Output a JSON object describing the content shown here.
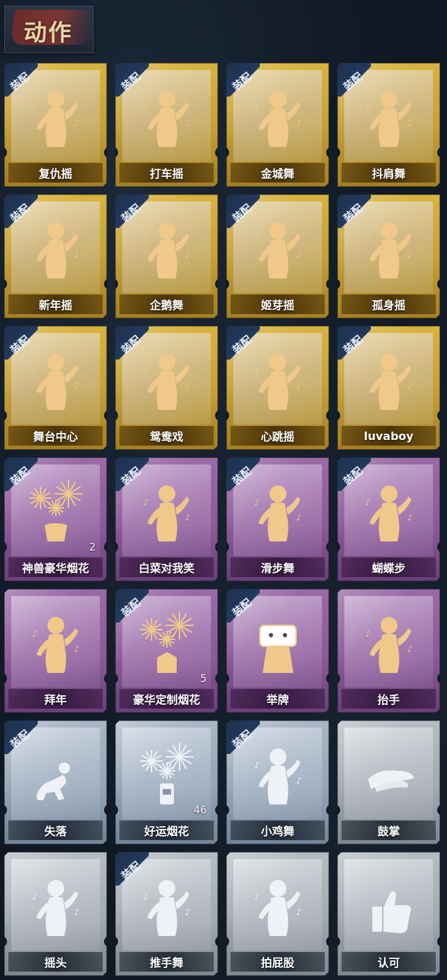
{
  "header": {
    "title": "动作"
  },
  "equip_label": "装配",
  "colors": {
    "gold": "#c7a137",
    "purple": "#8b5b98",
    "silver": "#95a4b5",
    "gray": "#a3a9b1",
    "figure": "#f0c98a"
  },
  "cards": [
    {
      "name": "复仇摇",
      "tier": "gold",
      "equipped": true,
      "icon": "dancer-arm-raised-icon",
      "count": ""
    },
    {
      "name": "打车摇",
      "tier": "gold",
      "equipped": true,
      "icon": "dancer-icon",
      "count": ""
    },
    {
      "name": "金城舞",
      "tier": "gold",
      "equipped": true,
      "icon": "dancer-wave-icon",
      "count": ""
    },
    {
      "name": "抖肩舞",
      "tier": "gold",
      "equipped": true,
      "icon": "dancer-shrug-icon",
      "count": ""
    },
    {
      "name": "新年摇",
      "tier": "gold",
      "equipped": true,
      "icon": "dancer-clap-icon",
      "count": ""
    },
    {
      "name": "企鹅舞",
      "tier": "gold",
      "equipped": true,
      "icon": "dancer-penguin-icon",
      "count": ""
    },
    {
      "name": "姬芽摇",
      "tier": "gold",
      "equipped": true,
      "icon": "dancer-hands-icon",
      "count": ""
    },
    {
      "name": "孤身摇",
      "tier": "gold",
      "equipped": true,
      "icon": "dancer-sway-icon",
      "count": ""
    },
    {
      "name": "舞台中心",
      "tier": "gold",
      "equipped": true,
      "icon": "dancer-center-icon",
      "count": ""
    },
    {
      "name": "鸳鸯戏",
      "tier": "gold",
      "equipped": true,
      "icon": "dancer-duo-icon",
      "count": ""
    },
    {
      "name": "心跳摇",
      "tier": "gold",
      "equipped": true,
      "icon": "dancer-heartbeat-icon",
      "count": ""
    },
    {
      "name": "luvaboy",
      "tier": "gold",
      "equipped": true,
      "icon": "dancer-luvaboy-icon",
      "count": ""
    },
    {
      "name": "神兽豪华烟花",
      "tier": "purple",
      "equipped": true,
      "icon": "fireworks-pot-icon",
      "count": "2"
    },
    {
      "name": "白菜对我笑",
      "tier": "purple",
      "equipped": true,
      "icon": "dancer-heart-icon",
      "count": ""
    },
    {
      "name": "滑步舞",
      "tier": "purple",
      "equipped": true,
      "icon": "dancer-slide-icon",
      "count": ""
    },
    {
      "name": "蝴蝶步",
      "tier": "purple",
      "equipped": true,
      "icon": "dancer-butterfly-icon",
      "count": ""
    },
    {
      "name": "拜年",
      "tier": "purple",
      "equipped": false,
      "icon": "bow-icon",
      "count": ""
    },
    {
      "name": "豪华定制烟花",
      "tier": "purple",
      "equipped": true,
      "icon": "fireworks-box-icon",
      "count": "5"
    },
    {
      "name": "举牌",
      "tier": "purple",
      "equipped": true,
      "icon": "sign-hold-icon",
      "count": ""
    },
    {
      "name": "抬手",
      "tier": "purple",
      "equipped": false,
      "icon": "raise-hand-icon",
      "count": ""
    },
    {
      "name": "失落",
      "tier": "silver",
      "equipped": true,
      "icon": "crawl-icon",
      "count": ""
    },
    {
      "name": "好运烟花",
      "tier": "silver",
      "equipped": false,
      "icon": "fireworks-can-icon",
      "count": "46"
    },
    {
      "name": "小鸡舞",
      "tier": "silver",
      "equipped": true,
      "icon": "chicken-dance-icon",
      "count": ""
    },
    {
      "name": "鼓掌",
      "tier": "gray",
      "equipped": false,
      "icon": "clap-icon",
      "count": ""
    },
    {
      "name": "摇头",
      "tier": "gray",
      "equipped": false,
      "icon": "head-shake-icon",
      "count": ""
    },
    {
      "name": "推手舞",
      "tier": "gray",
      "equipped": true,
      "icon": "push-hands-icon",
      "count": ""
    },
    {
      "name": "拍屁股",
      "tier": "gray",
      "equipped": false,
      "icon": "butt-slap-icon",
      "count": ""
    },
    {
      "name": "认可",
      "tier": "gray",
      "equipped": false,
      "icon": "thumbs-up-icon",
      "count": ""
    }
  ]
}
